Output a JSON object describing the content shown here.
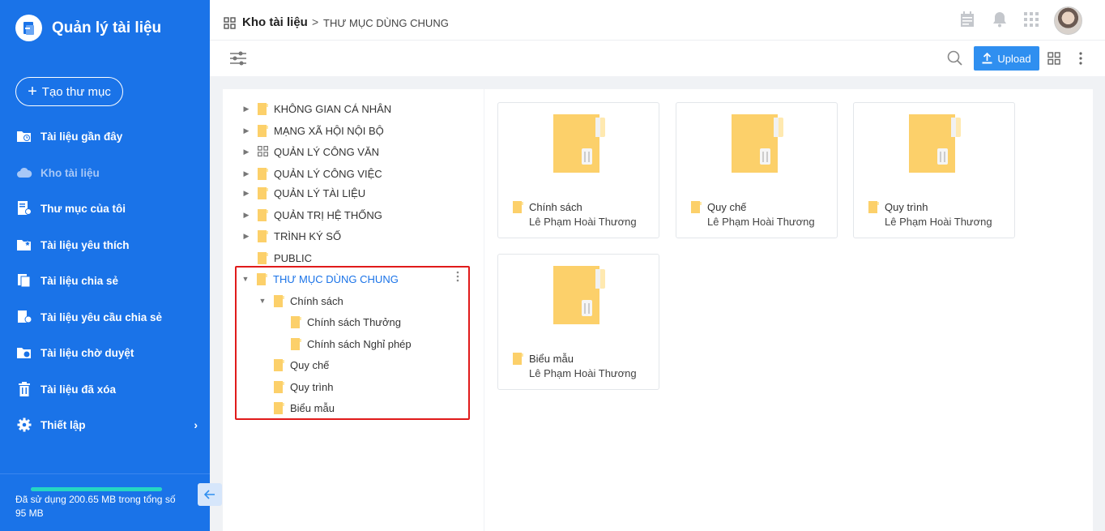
{
  "app": {
    "title": "Quản lý tài liệu",
    "brand_color": "#1a73e8"
  },
  "sidebar": {
    "create_label": "Tạo thư mục",
    "items": [
      {
        "label": "Tài liệu gần đây",
        "icon": "recent-docs-icon"
      },
      {
        "label": "Kho tài liệu",
        "icon": "cloud-icon",
        "active": true
      },
      {
        "label": "Thư mục của tôi",
        "icon": "my-folder-icon"
      },
      {
        "label": "Tài liệu yêu thích",
        "icon": "favorite-docs-icon"
      },
      {
        "label": "Tài liệu chia sẻ",
        "icon": "shared-docs-icon"
      },
      {
        "label": "Tài liệu yêu cầu chia sẻ",
        "icon": "share-request-icon"
      },
      {
        "label": "Tài liệu chờ duyệt",
        "icon": "pending-docs-icon"
      },
      {
        "label": "Tài liệu đã xóa",
        "icon": "trash-icon"
      },
      {
        "label": "Thiết lập",
        "icon": "gear-icon"
      }
    ],
    "storage": {
      "text": "Đã sử dụng 200.65 MB trong tổng số 95 MB",
      "used_fraction": 1.0,
      "bar_color": "#24d6c4"
    }
  },
  "header": {
    "breadcrumb_root": "Kho tài liệu",
    "breadcrumb_separator": ">",
    "breadcrumb_current": "THƯ MỤC DÙNG CHUNG"
  },
  "toolbar": {
    "upload_label": "Upload",
    "upload_color": "#2f8ff0"
  },
  "tree": {
    "items": [
      {
        "label": "KHÔNG GIAN CÁ NHÂN",
        "caret": "right",
        "icon": "folder"
      },
      {
        "label": "MẠNG XÃ HỘI NỘI BỘ",
        "caret": "right",
        "icon": "folder"
      },
      {
        "label": "QUẢN LÝ CÔNG VĂN",
        "caret": "right",
        "icon": "grid"
      },
      {
        "label": "QUẢN LÝ CÔNG VIỆC",
        "caret": "right",
        "icon": "folder"
      },
      {
        "label": "QUẢN LÝ TÀI LIỆU",
        "caret": "right",
        "icon": "folder"
      },
      {
        "label": "QUẢN TRỊ HỆ THỐNG",
        "caret": "right",
        "icon": "folder"
      },
      {
        "label": "TRÌNH KÝ SỐ",
        "caret": "right",
        "icon": "folder"
      },
      {
        "label": "PUBLIC",
        "caret": "none",
        "icon": "folder"
      },
      {
        "label": "THƯ MỤC DÙNG CHUNG",
        "caret": "down",
        "icon": "folder",
        "selected": true
      },
      {
        "label": "Chính sách",
        "caret": "down",
        "icon": "folder"
      },
      {
        "label": "Chính sách Thưởng",
        "caret": "none",
        "icon": "folder"
      },
      {
        "label": "Chính sách Nghỉ phép",
        "caret": "none",
        "icon": "folder"
      },
      {
        "label": "Quy chế",
        "caret": "none",
        "icon": "folder"
      },
      {
        "label": "Quy trình",
        "caret": "none",
        "icon": "folder"
      },
      {
        "label": "Biểu mẫu",
        "caret": "none",
        "icon": "folder"
      }
    ],
    "highlight_color": "#e01b1b"
  },
  "folders": [
    {
      "name": "Chính sách",
      "owner": "Lê Phạm Hoài Thương"
    },
    {
      "name": "Quy chế",
      "owner": "Lê Phạm Hoài Thương"
    },
    {
      "name": "Quy trình",
      "owner": "Lê Phạm Hoài Thương"
    },
    {
      "name": "Biểu mẫu",
      "owner": "Lê Phạm Hoài Thương"
    }
  ],
  "folder_color": "#fcd06a"
}
